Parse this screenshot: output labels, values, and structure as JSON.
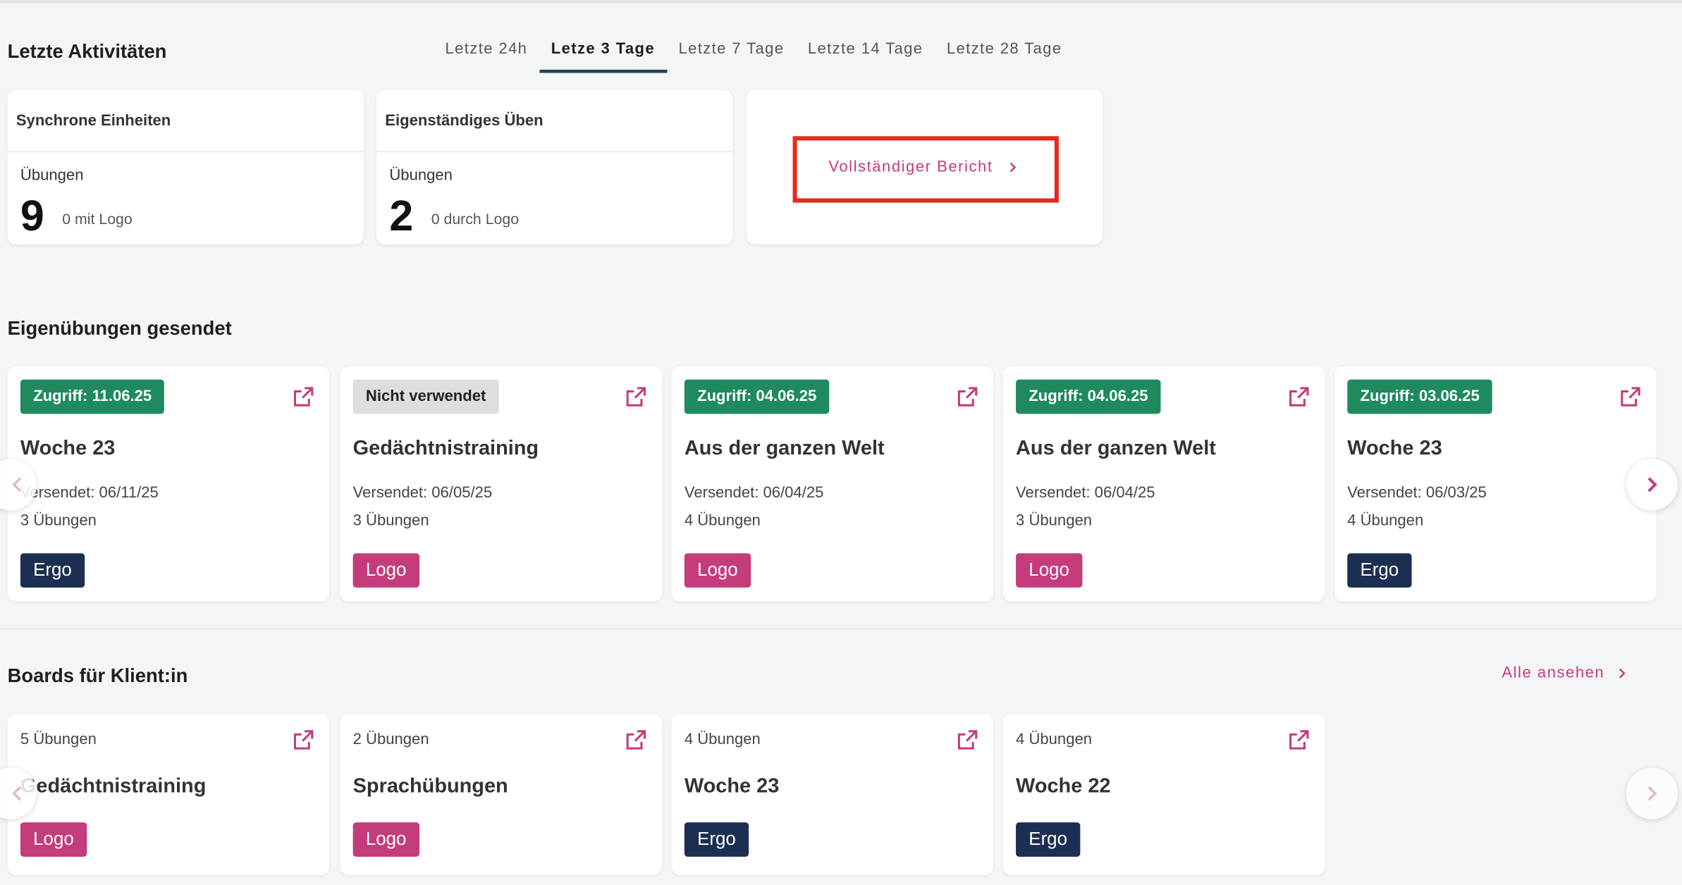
{
  "recent": {
    "title": "Letzte Aktivitäten",
    "tabs": [
      {
        "label": "Letzte 24h",
        "active": false
      },
      {
        "label": "Letze 3 Tage",
        "active": true
      },
      {
        "label": "Letzte 7 Tage",
        "active": false
      },
      {
        "label": "Letzte 14 Tage",
        "active": false
      },
      {
        "label": "Letzte 28 Tage",
        "active": false
      }
    ],
    "sync": {
      "title": "Synchrone Einheiten",
      "subtitle": "Übungen",
      "count": "9",
      "note": "0 mit Logo"
    },
    "self": {
      "title": "Eigenständiges Üben",
      "subtitle": "Übungen",
      "count": "2",
      "note": "0 durch Logo"
    },
    "report_link": "Vollständiger Bericht"
  },
  "exercises": {
    "title": "Eigenübungen gesendet",
    "cards": [
      {
        "badge": "Zugriff: 11.06.25",
        "badge_type": "green",
        "title": "Woche 23",
        "sent": "Versendet: 06/11/25",
        "count": "3 Übungen",
        "tag": "Ergo",
        "tag_type": "ergo"
      },
      {
        "badge": "Nicht verwendet",
        "badge_type": "grey",
        "title": "Gedächtnistraining",
        "sent": "Versendet: 06/05/25",
        "count": "3 Übungen",
        "tag": "Logo",
        "tag_type": "logo"
      },
      {
        "badge": "Zugriff: 04.06.25",
        "badge_type": "green",
        "title": "Aus der ganzen Welt",
        "sent": "Versendet: 06/04/25",
        "count": "4 Übungen",
        "tag": "Logo",
        "tag_type": "logo"
      },
      {
        "badge": "Zugriff: 04.06.25",
        "badge_type": "green",
        "title": "Aus der ganzen Welt",
        "sent": "Versendet: 06/04/25",
        "count": "3 Übungen",
        "tag": "Logo",
        "tag_type": "logo"
      },
      {
        "badge": "Zugriff: 03.06.25",
        "badge_type": "green",
        "title": "Woche 23",
        "sent": "Versendet: 06/03/25",
        "count": "4 Übungen",
        "tag": "Ergo",
        "tag_type": "ergo"
      }
    ]
  },
  "boards": {
    "title": "Boards für Klient:in",
    "all_link": "Alle ansehen",
    "cards": [
      {
        "count": "5 Übungen",
        "title": "Gedächtnistraining",
        "tag": "Logo",
        "tag_type": "logo"
      },
      {
        "count": "2 Übungen",
        "title": "Sprachübungen",
        "tag": "Logo",
        "tag_type": "logo"
      },
      {
        "count": "4 Übungen",
        "title": "Woche 23",
        "tag": "Ergo",
        "tag_type": "ergo"
      },
      {
        "count": "4 Übungen",
        "title": "Woche 22",
        "tag": "Ergo",
        "tag_type": "ergo"
      }
    ]
  },
  "icons": {
    "external": "external-link-icon",
    "prev": "chevron-left-icon",
    "next": "chevron-right-icon"
  },
  "colors": {
    "accent": "#c43c7a",
    "green": "#1f8a5e",
    "navy": "#1c2f52",
    "highlight": "#e52b1c"
  }
}
